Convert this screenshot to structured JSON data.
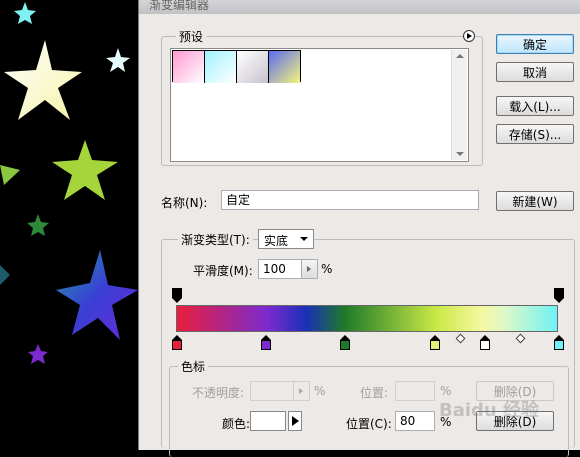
{
  "dialog": {
    "title": "渐变编辑器"
  },
  "presets": {
    "legend": "预设",
    "swatches": [
      "pink-white gradient",
      "cyan-white gradient",
      "gray-white gradient",
      "blue-yellow gradient"
    ]
  },
  "buttons": {
    "ok": "确定",
    "cancel": "取消",
    "load": "载入(L)...",
    "save": "存储(S)...",
    "new": "新建(W)"
  },
  "name_field": {
    "label": "名称(N):",
    "value": "自定"
  },
  "gradient_type": {
    "label": "渐变类型(T):",
    "value": "实底"
  },
  "smoothness": {
    "label": "平滑度(M):",
    "value": "100",
    "unit": "%"
  },
  "color_stops": {
    "legend": "色标",
    "opacity_label": "不透明度:",
    "opacity_unit": "%",
    "position_label_opacity": "位置:",
    "delete_opacity": "删除(D)",
    "color_label": "颜色:",
    "color_value": "#ffffff",
    "position_label": "位置(C):",
    "position_value": "80",
    "position_unit": "%",
    "delete_color": "删除(D)"
  },
  "colors": {
    "stops": [
      "#e81f3c",
      "#7a2bd0",
      "#1d7a2a",
      "#e6f07a",
      "#ffffff",
      "#6ff2f4"
    ]
  },
  "watermark": {
    "text": "Baidu 经验"
  }
}
